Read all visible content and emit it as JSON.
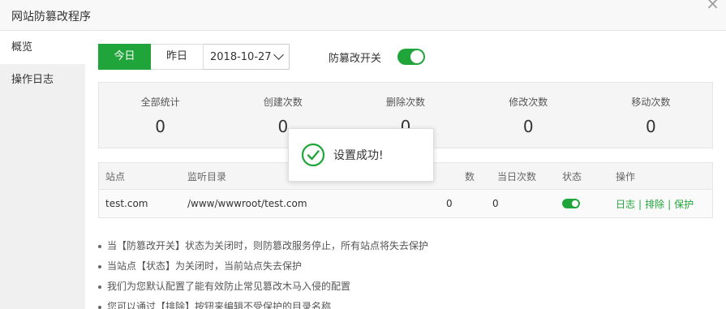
{
  "window": {
    "title": "网站防篡改程序",
    "close_glyph": "×"
  },
  "sidebar": {
    "items": [
      {
        "label": "概览"
      },
      {
        "label": "操作日志"
      }
    ]
  },
  "datebar": {
    "today": "今日",
    "yesterday": "昨日",
    "date_value": "2018-10-27"
  },
  "switch": {
    "label": "防篡改开关",
    "on": true
  },
  "stats": [
    {
      "label": "全部统计",
      "value": "0"
    },
    {
      "label": "创建次数",
      "value": "0"
    },
    {
      "label": "删除次数",
      "value": "0"
    },
    {
      "label": "修改次数",
      "value": "0"
    },
    {
      "label": "移动次数",
      "value": "0"
    }
  ],
  "table": {
    "headers": {
      "site": "站点",
      "dir": "监听目录",
      "total": "数",
      "today": "当日次数",
      "status": "状态",
      "ops": "操作"
    },
    "rows": [
      {
        "site": "test.com",
        "dir": "/www/wwwroot/test.com",
        "total": "0",
        "today": "0",
        "status_on": true,
        "op_log": "日志",
        "op_exclude": "排除",
        "op_protect": "保护",
        "sep": "|"
      }
    ]
  },
  "notes": [
    "当【防篡改开关】状态为关闭时，则防篡改服务停止，所有站点将失去保护",
    "当站点【状态】为关闭时，当前站点失去保护",
    "我们为您默认配置了能有效防止常见篡改木马入侵的配置",
    "您可以通过【排除】按钮来编辑不受保护的目录名称"
  ],
  "toast": {
    "message": "设置成功!",
    "icon": "check-circle-icon"
  },
  "colors": {
    "accent": "#20a53a"
  }
}
